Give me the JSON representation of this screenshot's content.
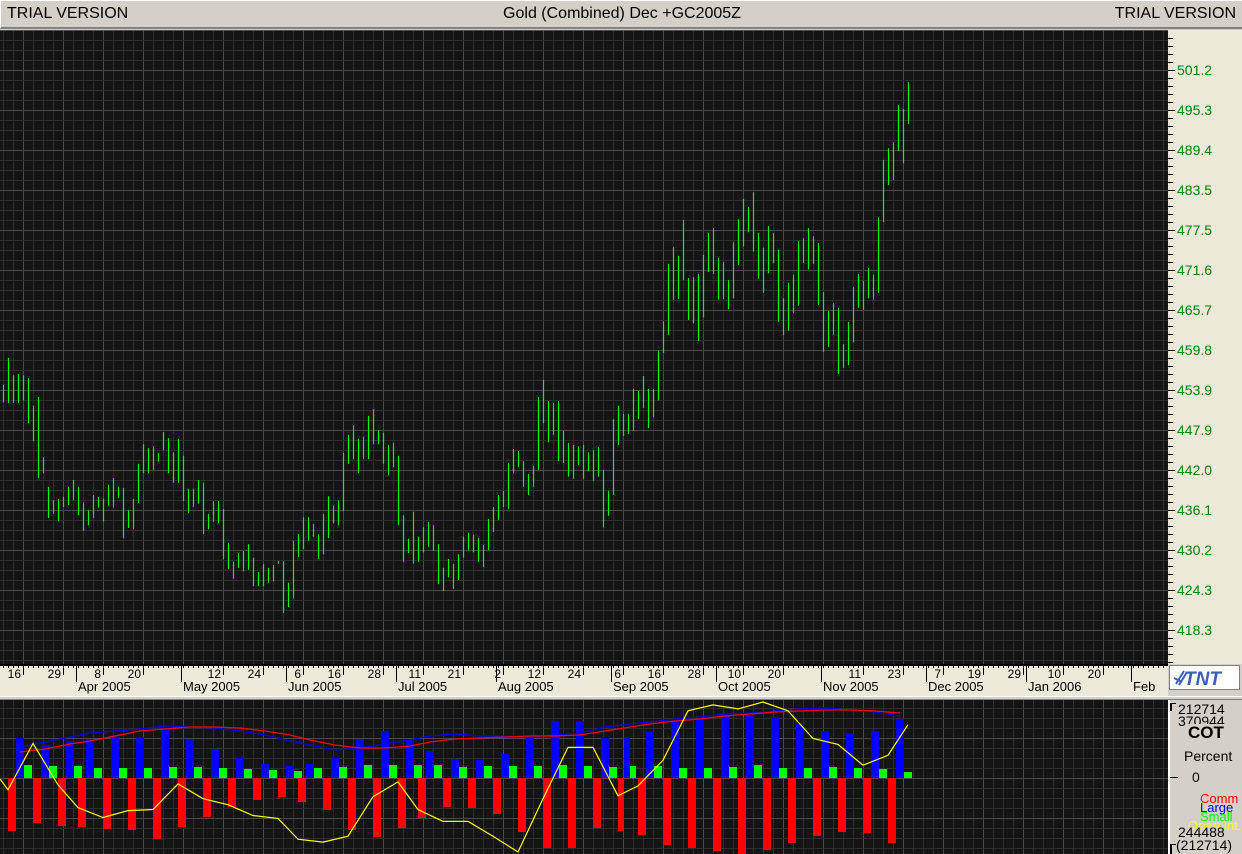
{
  "window": {
    "left_label": "TRIAL VERSION",
    "title": "Gold (Combined) Dec +GC2005Z",
    "right_label": "TRIAL VERSION",
    "logo_text": "TNT"
  },
  "colors": {
    "background": "#141414",
    "price_bars": "#00ff00",
    "price_axis_text": "#008000",
    "comm": "#ff0000",
    "large": "#0000ff",
    "small": "#00ff00",
    "open_interest": "#ffff00"
  },
  "chart_data": [
    {
      "type": "bar-hl",
      "title": "Gold (Combined) Dec +GC2005Z",
      "y_ticks": [
        "501.2",
        "495.3",
        "489.4",
        "483.5",
        "477.5",
        "471.6",
        "465.7",
        "459.8",
        "453.9",
        "447.9",
        "442.0",
        "436.1",
        "430.2",
        "424.3",
        "418.3"
      ],
      "grid": true,
      "x_ticks": [
        {
          "date": "2005-03-16",
          "label": "16"
        },
        {
          "date": "2005-03-29",
          "label": "29"
        },
        {
          "date": "2005-04-08",
          "label": "8"
        },
        {
          "date": "2005-04-20",
          "label": "20"
        },
        {
          "date": "2005-05-12",
          "label": "12"
        },
        {
          "date": "2005-05-24",
          "label": "24"
        },
        {
          "date": "2005-06-06",
          "label": "6"
        },
        {
          "date": "2005-06-16",
          "label": "16"
        },
        {
          "date": "2005-06-28",
          "label": "28"
        },
        {
          "date": "2005-07-11",
          "label": "11"
        },
        {
          "date": "2005-07-21",
          "label": "21"
        },
        {
          "date": "2005-08-02",
          "label": "2"
        },
        {
          "date": "2005-08-12",
          "label": "12"
        },
        {
          "date": "2005-08-24",
          "label": "24"
        },
        {
          "date": "2005-09-06",
          "label": "6"
        },
        {
          "date": "2005-09-16",
          "label": "16"
        },
        {
          "date": "2005-09-28",
          "label": "28"
        },
        {
          "date": "2005-10-10",
          "label": "10"
        },
        {
          "date": "2005-10-20",
          "label": "20"
        },
        {
          "date": "2005-11-11",
          "label": "11"
        },
        {
          "date": "2005-11-23",
          "label": "23"
        },
        {
          "date": "2005-12-07",
          "label": "7"
        },
        {
          "date": "2005-12-19",
          "label": "19"
        },
        {
          "date": "2005-12-29",
          "label": "29"
        },
        {
          "date": "2006-01-10",
          "label": "10"
        },
        {
          "date": "2006-01-20",
          "label": "20"
        }
      ],
      "months": [
        {
          "date": "2005-04-01",
          "label": "Apr 2005"
        },
        {
          "date": "2005-05-02",
          "label": "May 2005"
        },
        {
          "date": "2005-06-01",
          "label": "Jun 2005"
        },
        {
          "date": "2005-07-01",
          "label": "Jul 2005"
        },
        {
          "date": "2005-08-01",
          "label": "Aug 2005"
        },
        {
          "date": "2005-09-01",
          "label": "Sep 2005"
        },
        {
          "date": "2005-10-03",
          "label": "Oct 2005"
        },
        {
          "date": "2005-11-01",
          "label": "Nov 2005"
        },
        {
          "date": "2005-12-01",
          "label": "Dec 2005"
        },
        {
          "date": "2006-01-02",
          "label": "Jan 2006"
        },
        {
          "date": "2006-02-01",
          "label": "Feb"
        }
      ],
      "bars_high_low": [
        [
          454.6,
          452.0
        ],
        [
          458.6,
          451.9
        ],
        [
          456.0,
          451.9
        ],
        [
          456.2,
          451.9
        ],
        [
          456.0,
          452.3
        ],
        [
          455.6,
          448.9
        ],
        [
          451.5,
          446.3
        ],
        [
          452.8,
          440.8
        ],
        [
          443.9,
          441.5
        ],
        [
          439.5,
          434.9
        ],
        [
          437.5,
          435.5
        ],
        [
          437.7,
          434.4
        ],
        [
          438.0,
          436.5
        ],
        [
          439.5,
          436.8
        ],
        [
          440.5,
          437.5
        ],
        [
          439.5,
          435.3
        ],
        [
          437.2,
          433.0
        ],
        [
          436.1,
          433.8
        ],
        [
          438.3,
          434.9
        ],
        [
          438.0,
          436.4
        ],
        [
          437.8,
          434.4
        ],
        [
          439.8,
          436.7
        ],
        [
          440.8,
          436.4
        ],
        [
          439.5,
          437.8
        ],
        [
          439.3,
          431.9
        ],
        [
          436.1,
          433.4
        ],
        [
          437.7,
          433.2
        ],
        [
          442.9,
          437.1
        ],
        [
          445.8,
          441.5
        ],
        [
          445.2,
          441.5
        ],
        [
          445.5,
          442.0
        ],
        [
          444.5,
          443.2
        ],
        [
          447.6,
          444.9
        ],
        [
          446.7,
          441.5
        ],
        [
          444.6,
          440.1
        ],
        [
          446.6,
          440.1
        ],
        [
          444.1,
          437.4
        ],
        [
          439.2,
          435.6
        ],
        [
          439.2,
          436.5
        ],
        [
          440.5,
          437.0
        ],
        [
          440.1,
          432.5
        ],
        [
          435.5,
          433.2
        ],
        [
          437.4,
          434.3
        ],
        [
          437.4,
          434.1
        ],
        [
          436.2,
          428.8
        ],
        [
          431.2,
          427.3
        ],
        [
          428.4,
          425.9
        ],
        [
          429.7,
          427.5
        ],
        [
          430.0,
          427.0
        ],
        [
          431.0,
          427.2
        ],
        [
          429.0,
          424.8
        ],
        [
          426.9,
          424.8
        ],
        [
          428.1,
          424.8
        ],
        [
          427.5,
          425.3
        ],
        [
          427.9,
          425.5
        ],
        [
          428.5,
          428.1
        ],
        [
          428.5,
          420.8
        ],
        [
          425.3,
          421.7
        ],
        [
          431.5,
          423.0
        ],
        [
          432.5,
          429.1
        ],
        [
          435.0,
          430.3
        ],
        [
          435.0,
          431.5
        ],
        [
          434.0,
          432.1
        ],
        [
          432.5,
          428.8
        ],
        [
          435.5,
          429.5
        ],
        [
          438.1,
          431.9
        ],
        [
          436.7,
          434.1
        ],
        [
          437.5,
          433.8
        ],
        [
          444.5,
          435.9
        ],
        [
          447.2,
          442.9
        ],
        [
          448.6,
          443.6
        ],
        [
          446.6,
          441.5
        ],
        [
          446.9,
          443.6
        ],
        [
          450.0,
          443.6
        ],
        [
          451.0,
          445.8
        ],
        [
          447.9,
          445.8
        ],
        [
          447.5,
          442.9
        ],
        [
          445.7,
          441.2
        ],
        [
          446.0,
          442.4
        ],
        [
          444.1,
          433.8
        ],
        [
          435.3,
          428.4
        ],
        [
          431.8,
          429.7
        ],
        [
          435.8,
          428.1
        ],
        [
          432.1,
          428.4
        ],
        [
          433.5,
          429.8
        ],
        [
          434.3,
          430.6
        ],
        [
          433.8,
          430.0
        ],
        [
          431.0,
          425.1
        ],
        [
          427.5,
          424.1
        ],
        [
          428.8,
          426.1
        ],
        [
          428.1,
          424.4
        ],
        [
          429.5,
          425.7
        ],
        [
          432.1,
          429.0
        ],
        [
          432.7,
          430.1
        ],
        [
          432.4,
          429.8
        ],
        [
          431.9,
          428.4
        ],
        [
          430.9,
          427.6
        ],
        [
          434.7,
          430.1
        ],
        [
          436.5,
          432.8
        ],
        [
          438.3,
          434.6
        ],
        [
          438.9,
          436.5
        ],
        [
          443.0,
          436.2
        ],
        [
          445.1,
          441.5
        ],
        [
          444.8,
          442.4
        ],
        [
          443.3,
          439.5
        ],
        [
          441.4,
          438.3
        ],
        [
          442.6,
          439.5
        ],
        [
          452.8,
          442.0
        ],
        [
          455.3,
          448.9
        ],
        [
          452.2,
          446.1
        ],
        [
          451.9,
          447.2
        ],
        [
          452.2,
          443.3
        ],
        [
          447.8,
          443.0
        ],
        [
          446.0,
          441.0
        ],
        [
          445.7,
          440.7
        ],
        [
          445.5,
          442.7
        ],
        [
          445.7,
          440.7
        ],
        [
          444.6,
          441.8
        ],
        [
          444.9,
          440.4
        ],
        [
          445.4,
          441.0
        ],
        [
          442.0,
          433.5
        ],
        [
          438.9,
          435.2
        ],
        [
          449.5,
          438.3
        ],
        [
          451.5,
          445.7
        ],
        [
          450.3,
          447.0
        ],
        [
          450.3,
          447.3
        ],
        [
          454.0,
          447.8
        ],
        [
          453.7,
          449.5
        ],
        [
          455.9,
          451.2
        ],
        [
          454.0,
          448.2
        ],
        [
          454.0,
          449.8
        ],
        [
          459.7,
          452.3
        ],
        [
          464.0,
          459.3
        ],
        [
          472.5,
          462.0
        ],
        [
          475.0,
          467.2
        ],
        [
          473.7,
          467.3
        ],
        [
          479.0,
          470.1
        ],
        [
          470.4,
          464.2
        ],
        [
          470.5,
          463.7
        ],
        [
          471.0,
          461.1
        ],
        [
          473.8,
          464.6
        ],
        [
          477.1,
          471.3
        ],
        [
          477.8,
          471.0
        ],
        [
          473.4,
          467.2
        ],
        [
          472.8,
          467.3
        ],
        [
          470.1,
          465.8
        ],
        [
          475.7,
          467.4
        ],
        [
          479.1,
          472.3
        ],
        [
          482.1,
          475.1
        ],
        [
          480.9,
          477.2
        ],
        [
          483.1,
          474.3
        ],
        [
          477.1,
          470.3
        ],
        [
          474.9,
          468.2
        ],
        [
          478.1,
          471.1
        ],
        [
          477.1,
          472.6
        ],
        [
          474.6,
          463.9
        ],
        [
          467.4,
          462.0
        ],
        [
          469.7,
          462.6
        ],
        [
          470.9,
          465.2
        ],
        [
          475.9,
          466.3
        ],
        [
          476.3,
          472.6
        ],
        [
          477.8,
          471.7
        ],
        [
          476.6,
          472.5
        ],
        [
          475.6,
          466.4
        ],
        [
          468.3,
          459.5
        ],
        [
          465.5,
          460.2
        ],
        [
          466.7,
          462.0
        ],
        [
          466.0,
          456.2
        ],
        [
          460.6,
          457.1
        ],
        [
          463.9,
          457.5
        ],
        [
          469.1,
          460.9
        ],
        [
          471.0,
          466.0
        ],
        [
          470.0,
          465.7
        ],
        [
          471.9,
          467.4
        ],
        [
          470.9,
          467.2
        ],
        [
          479.4,
          468.2
        ],
        [
          487.9,
          478.7
        ],
        [
          489.6,
          484.2
        ],
        [
          490.5,
          484.9
        ],
        [
          496.0,
          489.2
        ],
        [
          495.4,
          487.4
        ],
        [
          499.4,
          493.2
        ]
      ]
    },
    {
      "type": "bar",
      "title": "COT",
      "unit_label": "Percent",
      "axis_labels": {
        "top": "212714",
        "oi_top": "370944",
        "zero": "0",
        "oi_bottom": "244488",
        "bottom": "(212714)"
      },
      "ylim": [
        -212714,
        212714
      ],
      "oi_lim": [
        244488,
        370944
      ],
      "legend": [
        "Comm",
        "Large",
        "Small",
        "Open Int."
      ],
      "series": [
        {
          "name": "Comm",
          "values": [
            -148400,
            -126000,
            -134400,
            -137200,
            -142800,
            -145600,
            -170800,
            -137200,
            -109200,
            -81200,
            -61600,
            -53200,
            -67200,
            -89600,
            -145600,
            -165200,
            -140000,
            -112000,
            -81200,
            -84000,
            -100800,
            -151200,
            -196000,
            -196000,
            -140000,
            -148400,
            -159600,
            -187600,
            -196000,
            -204400,
            -212714,
            -201600,
            -182000,
            -162400,
            -151200,
            -154000,
            -182000
          ]
        },
        {
          "name": "Large",
          "values": [
            112000,
            92400,
            103600,
            109200,
            114800,
            114800,
            137200,
            109200,
            81200,
            56000,
            39200,
            33600,
            39200,
            56000,
            109200,
            131600,
            106400,
            75600,
            53200,
            50400,
            67200,
            114800,
            159600,
            159600,
            112000,
            114800,
            128800,
            159600,
            165200,
            176400,
            176400,
            170800,
            154000,
            131600,
            123200,
            131600,
            165200
          ]
        },
        {
          "name": "Small",
          "values": [
            36400,
            33600,
            33600,
            28000,
            28000,
            28000,
            30800,
            30800,
            28000,
            25200,
            22400,
            19600,
            28000,
            30800,
            36400,
            36400,
            36400,
            36400,
            30800,
            33600,
            33600,
            33600,
            36400,
            33600,
            30800,
            33600,
            33600,
            28000,
            28000,
            30800,
            36400,
            28000,
            28000,
            30800,
            28000,
            25200,
            16800
          ]
        },
        {
          "name": "Open Int.",
          "values": [
            306100,
            296900,
            336000,
            301100,
            281900,
            273600,
            279400,
            280300,
            301900,
            289400,
            284400,
            275300,
            272800,
            255300,
            252800,
            257800,
            291100,
            303600,
            280300,
            270300,
            270300,
            257800,
            244488,
            289400,
            332700,
            332700,
            291900,
            300200,
            321900,
            363500,
            368500,
            365100,
            370944,
            363500,
            340200,
            335200,
            317700,
            326000,
            351800
          ]
        },
        {
          "line_color": "#0000ff",
          "values": [
            86800,
            100800,
            114800,
            126000,
            131600,
            137200,
            145600,
            142800,
            140000,
            131600,
            120400,
            103600,
            92400,
            78400,
            84000,
            95200,
            106400,
            117600,
            123200,
            117600,
            117600,
            114800,
            120400,
            126000,
            142800,
            151200,
            156800,
            165200,
            170800,
            179200,
            182000,
            187600,
            193200,
            196000,
            190400,
            184800,
            173600
          ]
        },
        {
          "line_color": "#ff0000",
          "values": [
            72800,
            81200,
            95200,
            103600,
            117600,
            131600,
            137200,
            142800,
            142800,
            140000,
            131600,
            120400,
            106400,
            92400,
            84000,
            84000,
            89600,
            100800,
            109200,
            112000,
            114800,
            117600,
            117600,
            120400,
            131600,
            142800,
            151200,
            159600,
            165200,
            173600,
            179200,
            184800,
            187600,
            190400,
            190400,
            187600,
            182000
          ]
        }
      ]
    }
  ]
}
